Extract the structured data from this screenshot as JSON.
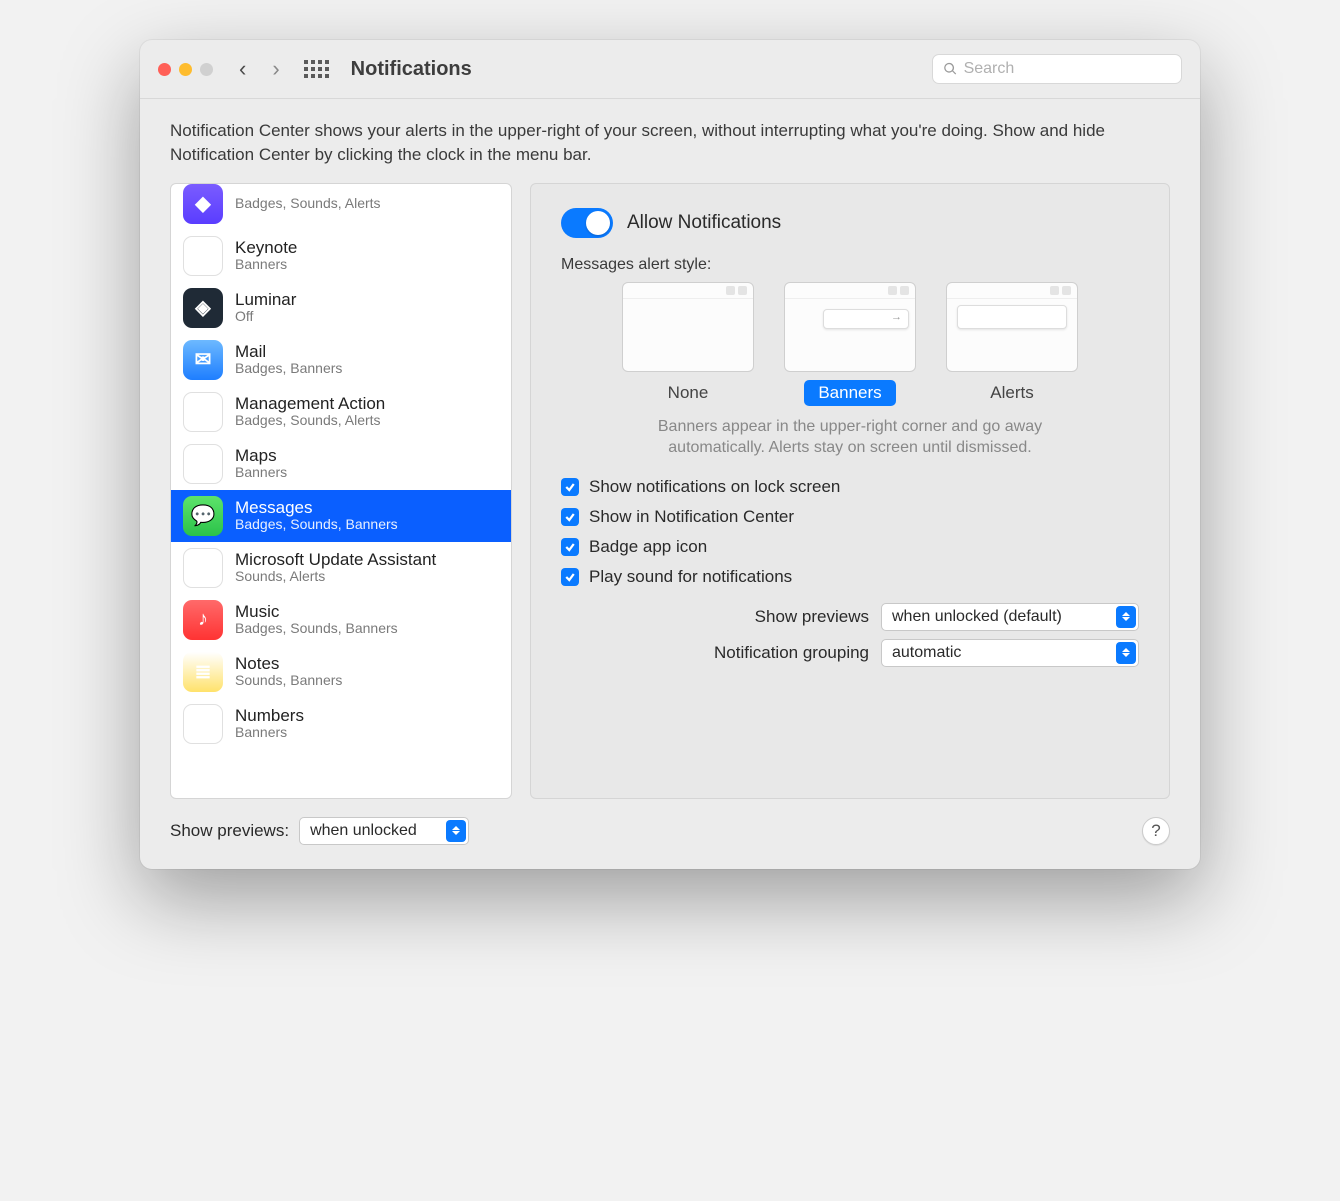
{
  "window": {
    "title": "Notifications",
    "search_placeholder": "Search"
  },
  "intro": "Notification Center shows your alerts in the upper-right of your screen, without interrupting what you're doing. Show and hide Notification Center by clicking the clock in the menu bar.",
  "apps": [
    {
      "name": "",
      "sub": "Badges, Sounds, Alerts",
      "icon": "ic-violet",
      "partialTop": true
    },
    {
      "name": "Keynote",
      "sub": "Banners",
      "icon": "ic-white"
    },
    {
      "name": "Luminar",
      "sub": "Off",
      "icon": "ic-dark"
    },
    {
      "name": "Mail",
      "sub": "Badges, Banners",
      "icon": "ic-blue"
    },
    {
      "name": "Management Action",
      "sub": "Badges, Sounds, Alerts",
      "icon": "ic-multi"
    },
    {
      "name": "Maps",
      "sub": "Banners",
      "icon": "ic-maps"
    },
    {
      "name": "Messages",
      "sub": "Badges, Sounds, Banners",
      "icon": "ic-green",
      "selected": true
    },
    {
      "name": "Microsoft Update Assistant",
      "sub": "Sounds, Alerts",
      "icon": "ic-white"
    },
    {
      "name": "Music",
      "sub": "Badges, Sounds, Banners",
      "icon": "ic-red"
    },
    {
      "name": "Notes",
      "sub": "Sounds, Banners",
      "icon": "ic-yellow"
    },
    {
      "name": "Numbers",
      "sub": "Banners",
      "icon": "ic-white"
    }
  ],
  "detail": {
    "allow_label": "Allow Notifications",
    "allow_on": true,
    "style_heading": "Messages alert style:",
    "styles": [
      "None",
      "Banners",
      "Alerts"
    ],
    "style_selected": "Banners",
    "helper": "Banners appear in the upper-right corner and go away automatically. Alerts stay on screen until dismissed.",
    "checks": [
      {
        "label": "Show notifications on lock screen",
        "checked": true
      },
      {
        "label": "Show in Notification Center",
        "checked": true
      },
      {
        "label": "Badge app icon",
        "checked": true
      },
      {
        "label": "Play sound for notifications",
        "checked": true
      }
    ],
    "selects": [
      {
        "label": "Show previews",
        "value": "when unlocked (default)"
      },
      {
        "label": "Notification grouping",
        "value": "automatic"
      }
    ]
  },
  "footer": {
    "label": "Show previews:",
    "value": "when unlocked",
    "help": "?"
  }
}
